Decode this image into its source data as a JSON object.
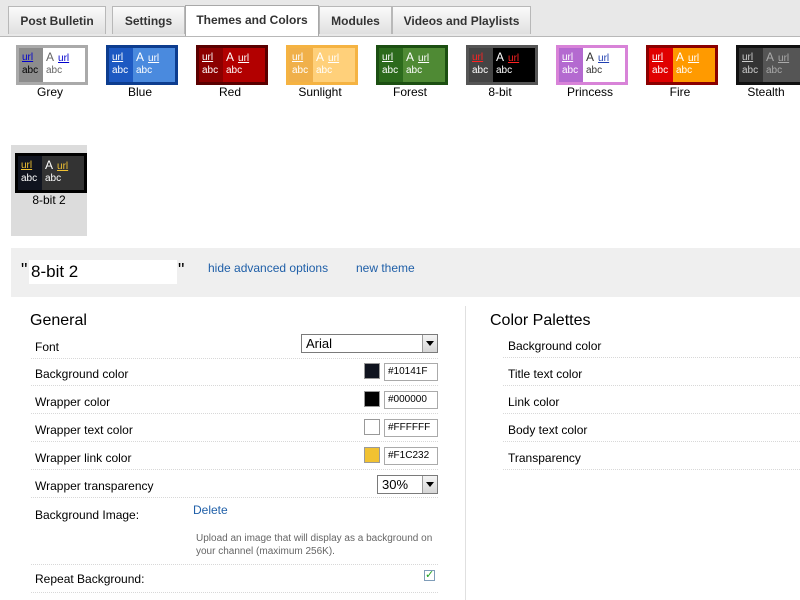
{
  "tabs": [
    {
      "label": "Post Bulletin"
    },
    {
      "label": "Settings"
    },
    {
      "label": "Themes and Colors"
    },
    {
      "label": "Modules"
    },
    {
      "label": "Videos and Playlists"
    }
  ],
  "themes": [
    {
      "name": "Grey",
      "url": "url",
      "a": "A",
      "abc": "abc",
      "selected": false
    },
    {
      "name": "Blue",
      "url": "url",
      "a": "A",
      "abc": "abc",
      "selected": false
    },
    {
      "name": "Red",
      "url": "url",
      "a": "A",
      "abc": "abc",
      "selected": false
    },
    {
      "name": "Sunlight",
      "url": "url",
      "a": "A",
      "abc": "abc",
      "selected": false
    },
    {
      "name": "Forest",
      "url": "url",
      "a": "A",
      "abc": "abc",
      "selected": false
    },
    {
      "name": "8-bit",
      "url": "url",
      "a": "A",
      "abc": "abc",
      "selected": false
    },
    {
      "name": "Princess",
      "url": "url",
      "a": "A",
      "abc": "abc",
      "selected": false
    },
    {
      "name": "Fire",
      "url": "url",
      "a": "A",
      "abc": "abc",
      "selected": false
    },
    {
      "name": "Stealth",
      "url": "url",
      "a": "A",
      "abc": "abc",
      "selected": false
    },
    {
      "name": "8-bit 2",
      "url": "url",
      "a": "A",
      "abc": "abc",
      "selected": true
    }
  ],
  "theme_colors": [
    {
      "border": "#aaaaaa",
      "left": "#8c8c8c",
      "right": "#ffffff",
      "url": "#0000cc",
      "text": "#000000",
      "urlR": "#0000cc",
      "textR": "#666666"
    },
    {
      "border": "#0d3d8f",
      "left": "#1d59c2",
      "right": "#4a8ade",
      "url": "#ffffff",
      "text": "#ffffff",
      "urlR": "#ffffff",
      "textR": "#ffffff"
    },
    {
      "border": "#5a0000",
      "left": "#8b0000",
      "right": "#b20000",
      "url": "#ffffff",
      "text": "#ffffff",
      "urlR": "#ffffff",
      "textR": "#ffffff"
    },
    {
      "border": "#f5b342",
      "left": "#f0b04a",
      "right": "#ffd07a",
      "url": "#ffffff",
      "text": "#ffffff",
      "urlR": "#ffffff",
      "textR": "#ffffff"
    },
    {
      "border": "#1c4f12",
      "left": "#2c6a1c",
      "right": "#4f8a34",
      "url": "#ffffff",
      "text": "#ffffff",
      "urlR": "#ffffff",
      "textR": "#ffffff"
    },
    {
      "border": "#555555",
      "left": "#444444",
      "right": "#000000",
      "url": "#ff2222",
      "text": "#ffffff",
      "urlR": "#ff2222",
      "textR": "#ffffff"
    },
    {
      "border": "#d883d8",
      "left": "#b46ad0",
      "right": "#ffffff",
      "url": "#ffffff",
      "text": "#ffffff",
      "urlR": "#1f3fb0",
      "textR": "#333333"
    },
    {
      "border": "#8b0000",
      "left": "#e00000",
      "right": "#ff9a00",
      "url": "#ffffff",
      "text": "#ffffff",
      "urlR": "#ffffff",
      "textR": "#ffffff"
    },
    {
      "border": "#111111",
      "left": "#333333",
      "right": "#555555",
      "url": "#cccccc",
      "text": "#cccccc",
      "urlR": "#aaaaaa",
      "textR": "#aaaaaa"
    },
    {
      "border": "#000000",
      "left": "#10141f",
      "right": "#333333",
      "url": "#f1c232",
      "text": "#ffffff",
      "urlR": "#f1c232",
      "textR": "#ffffff"
    }
  ],
  "namebar": {
    "quote_open": "\"",
    "theme_name_value": "8-bit 2",
    "quote_close": "\"",
    "hide_advanced": "hide advanced options",
    "new_theme": "new theme"
  },
  "general": {
    "title": "General",
    "font_label": "Font",
    "font_value": "Arial",
    "background_color_label": "Background color",
    "background_color_hex": "#10141F",
    "wrapper_color_label": "Wrapper color",
    "wrapper_color_hex": "#000000",
    "wrapper_text_color_label": "Wrapper text color",
    "wrapper_text_color_hex": "#FFFFFF",
    "wrapper_link_color_label": "Wrapper link color",
    "wrapper_link_color_hex": "#F1C232",
    "wrapper_transparency_label": "Wrapper transparency",
    "wrapper_transparency_value": "30%",
    "background_image_label": "Background Image:",
    "delete_label": "Delete",
    "upload_note": "Upload an image that will display as a background on your channel (maximum 256K).",
    "repeat_background_label": "Repeat Background:",
    "repeat_background_checked": true
  },
  "palettes": {
    "title": "Color Palettes",
    "items": [
      "Background color",
      "Title text color",
      "Link color",
      "Body text color",
      "Transparency"
    ]
  }
}
